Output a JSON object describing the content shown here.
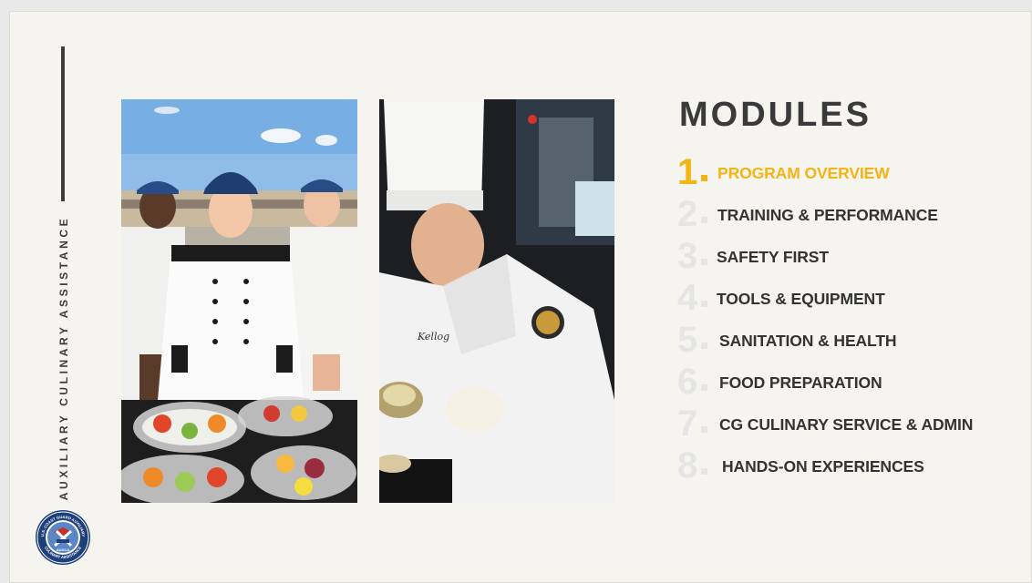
{
  "sidebar": {
    "vertical_title": "AUXILIARY CULINARY ASSISTANCE",
    "emblem_text_top": "U.S. COAST GUARD AUXILIARY",
    "emblem_text_bottom": "CULINARY ASSISTANCE",
    "emblem_center": "AUXCA"
  },
  "photos": {
    "left_alt": "Three culinary team members in chef coats behind vegetable and fruit trays",
    "right_alt": "Chef in toque plating food",
    "right_name_tag": "Kellog"
  },
  "heading": "MODULES",
  "accent_color": "#f3b416",
  "modules": [
    {
      "number": "1",
      "label": "PROGRAM OVERVIEW",
      "active": true
    },
    {
      "number": "2",
      "label": "TRAINING & PERFORMANCE",
      "active": false
    },
    {
      "number": "3",
      "label": "SAFETY FIRST",
      "active": false
    },
    {
      "number": "4",
      "label": "TOOLS & EQUIPMENT",
      "active": false
    },
    {
      "number": "5",
      "label": "SANITATION & HEALTH",
      "active": false
    },
    {
      "number": "6",
      "label": "FOOD PREPARATION",
      "active": false
    },
    {
      "number": "7",
      "label": "CG CULINARY SERVICE & ADMIN",
      "active": false
    },
    {
      "number": "8",
      "label": "HANDS-ON EXPERIENCES",
      "active": false
    }
  ]
}
